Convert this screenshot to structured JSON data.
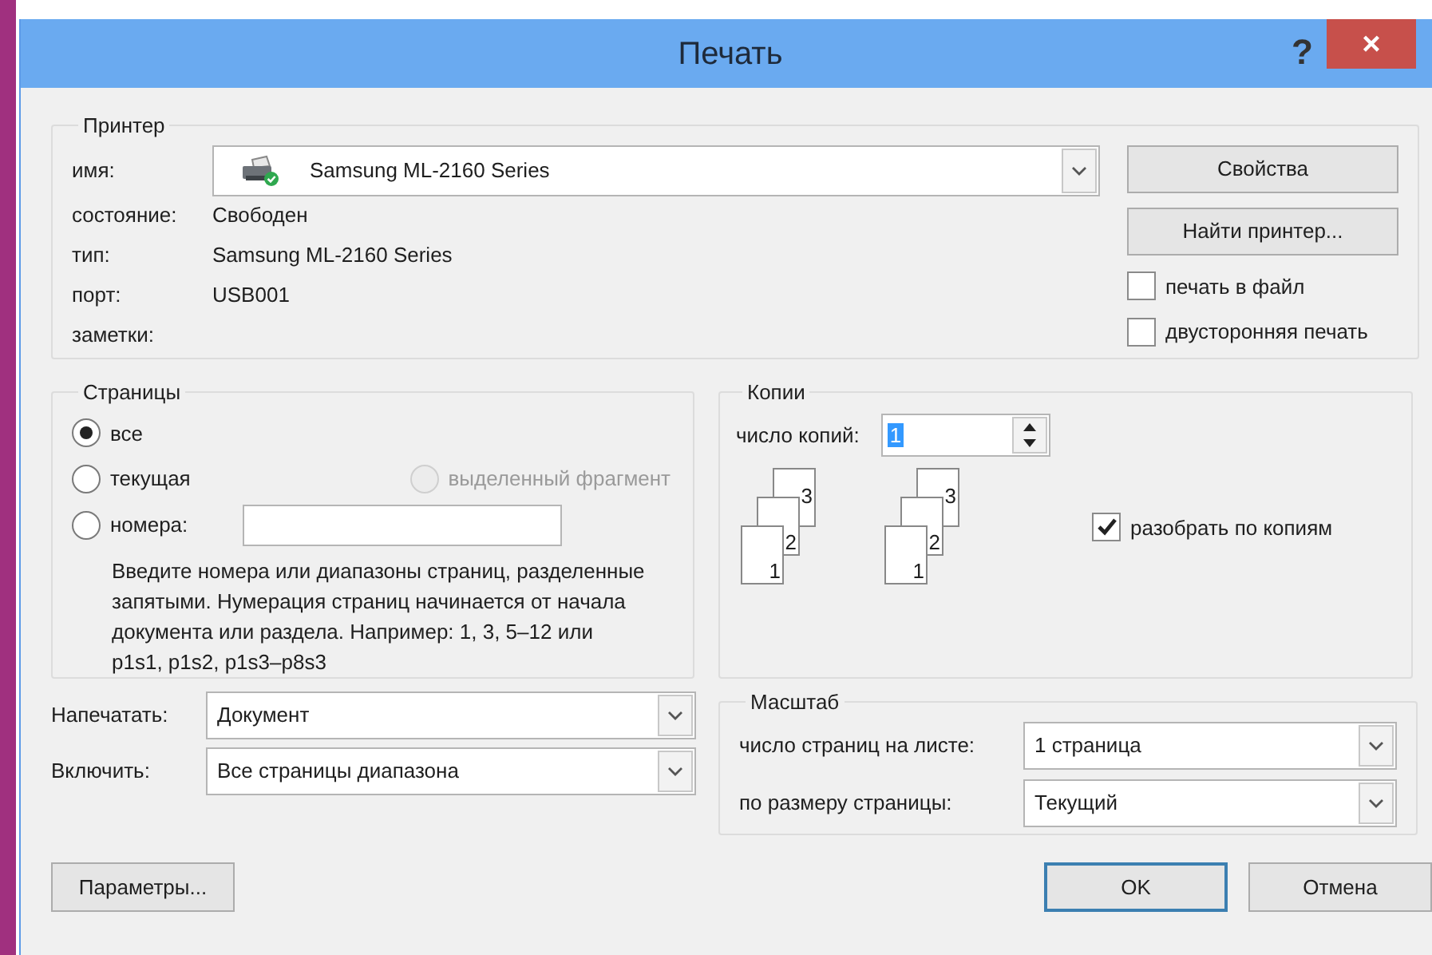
{
  "window": {
    "title": "Печать",
    "help": "?",
    "close": "×"
  },
  "printer": {
    "legend": "Принтер",
    "name_label": "имя:",
    "name": "Samsung ML-2160 Series",
    "fields": [
      {
        "label": "состояние:",
        "value": "Свободен"
      },
      {
        "label": "тип:",
        "value": "Samsung ML-2160 Series"
      },
      {
        "label": "порт:",
        "value": "USB001"
      },
      {
        "label": "заметки:"
      }
    ],
    "buttons": [
      "Свойства",
      "Найти принтер..."
    ],
    "options": [
      {
        "label": "печать в файл",
        "checked": false
      },
      {
        "label": "двусторонняя печать",
        "checked": false
      }
    ]
  },
  "pages": {
    "legend": "Страницы",
    "choices": [
      {
        "label": "все",
        "selected": true,
        "disabled": false
      },
      {
        "label": "текущая",
        "selected": false,
        "disabled": false
      },
      {
        "label": "выделенный фрагмент",
        "selected": false,
        "disabled": true
      },
      {
        "label": "номера:",
        "selected": false,
        "disabled": false
      }
    ],
    "hint": "Введите номера или диапазоны страниц, разделенные запятыми. Нумерация страниц начинается от начала документа или раздела. Например: 1, 3, 5–12 или p1s1, p1s2, p1s3–p8s3"
  },
  "copies": {
    "legend": "Копии",
    "count_label": "число копий:",
    "count": "1",
    "stacks": [
      [
        "3",
        "2",
        "1"
      ],
      [
        "3",
        "2",
        "1"
      ]
    ],
    "collate": {
      "label": "разобрать по копиям",
      "checked": true
    }
  },
  "print_what": {
    "label": "Напечатать:",
    "value": "Документ"
  },
  "include": {
    "label": "Включить:",
    "value": "Все страницы диапазона"
  },
  "zoom": {
    "legend": "Масштаб",
    "rows": [
      {
        "label": "число страниц на листе:",
        "value": "1 страница"
      },
      {
        "label": "по размеру страницы:",
        "value": "Текущий"
      }
    ]
  },
  "footer": [
    {
      "label": "Параметры...",
      "default": false
    },
    {
      "label": "OK",
      "default": true
    },
    {
      "label": "Отмена",
      "default": false
    }
  ]
}
